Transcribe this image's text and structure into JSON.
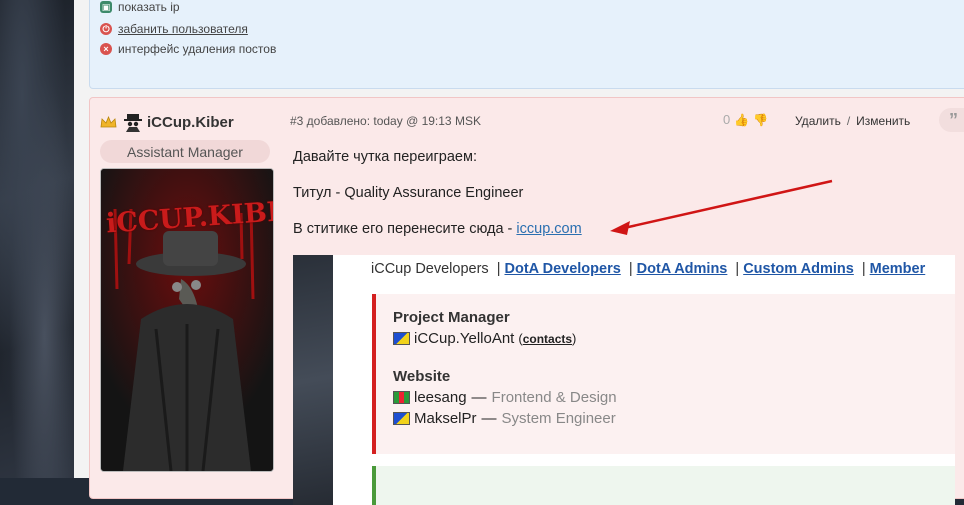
{
  "admin_panel": {
    "items": [
      {
        "label": "показать ip",
        "icon": "monitor-icon",
        "link": false
      },
      {
        "label": "забанить пользователя",
        "icon": "power-icon",
        "link": true
      },
      {
        "label": "интерфейс удаления постов",
        "icon": "delete-circle-icon",
        "link": false
      }
    ]
  },
  "post": {
    "author": {
      "name": "iCCup.Kiber",
      "rank": "Assistant Manager",
      "avatar_text": "iCCUP.KIBER"
    },
    "meta": "#3 добавлено: today @ 19:13 MSK",
    "votes": "0",
    "actions": {
      "delete": "Удалить",
      "separator": "/",
      "edit": "Изменить"
    },
    "quote_glyph": "”",
    "body": {
      "line1": "Давайте чутка переиграем:",
      "line2": "Титул - Quality Assurance Engineer",
      "line3_prefix": "В ститике его перенесите сюда - ",
      "line3_link": "iccup.com"
    },
    "embed": {
      "nav_current": "iCCup Developers",
      "nav_links": [
        "DotA Developers",
        "DotA Admins",
        "Custom Admins",
        "Member"
      ],
      "separator": "|",
      "sections": [
        {
          "title": "Project Manager",
          "members": [
            {
              "name": "iCCup.YelloAnt",
              "role": "",
              "contacts": "contacts",
              "flag": "ua"
            }
          ]
        },
        {
          "title": "Website",
          "members": [
            {
              "name": "leesang",
              "role": "Frontend & Design",
              "flag": "mx"
            },
            {
              "name": "MakselPr",
              "role": "System Engineer",
              "flag": "ua"
            }
          ]
        }
      ],
      "dash": "—"
    }
  },
  "colors": {
    "accent_red": "#d42020",
    "link_blue": "#1f56a6",
    "annotation_arrow": "#d01515"
  }
}
